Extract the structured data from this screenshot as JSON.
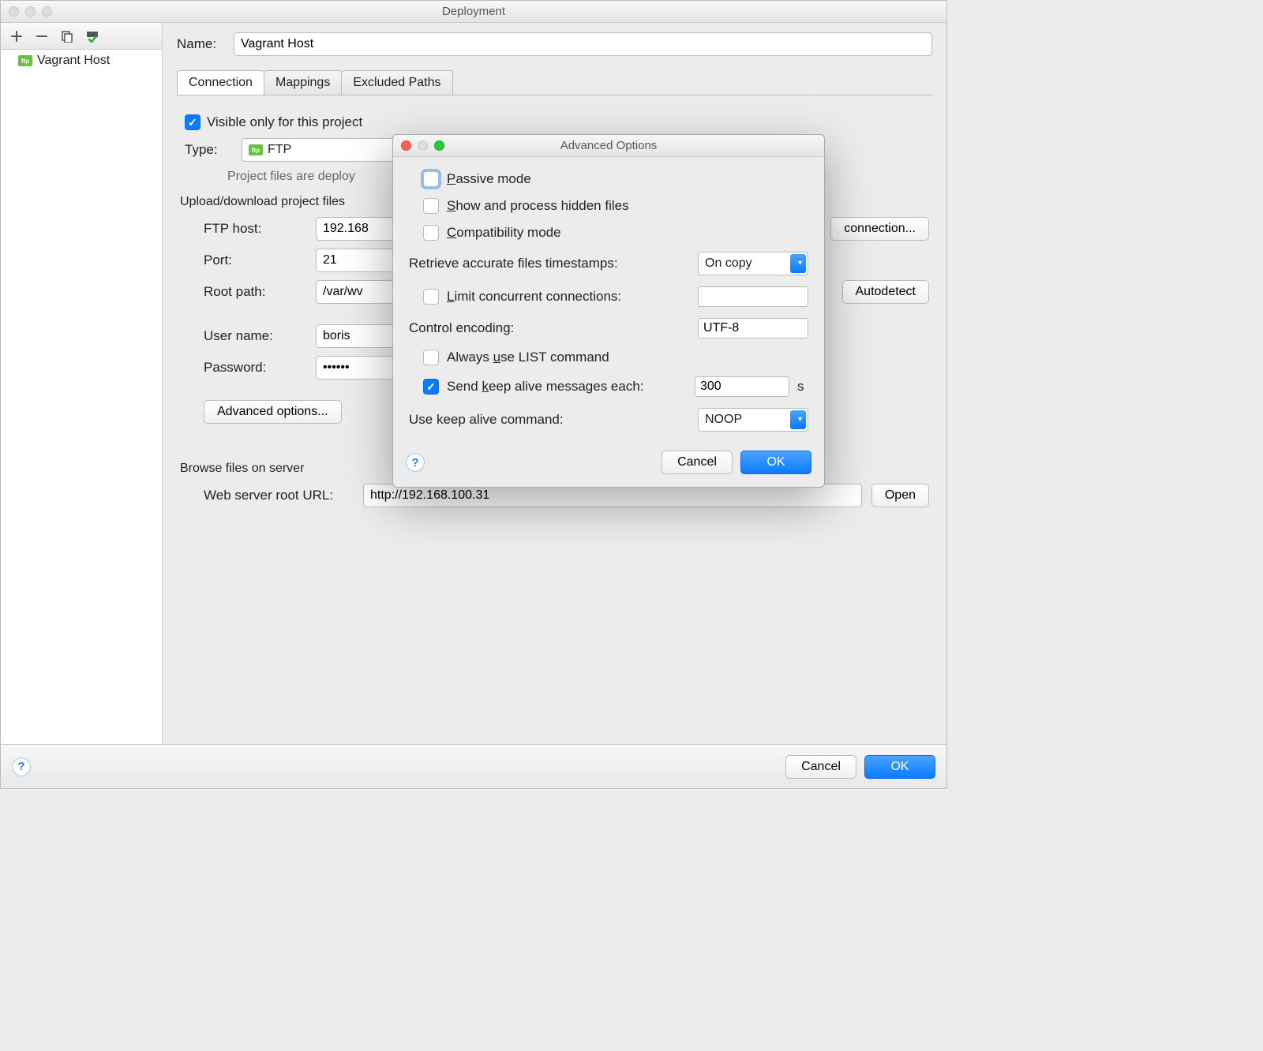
{
  "window": {
    "title": "Deployment"
  },
  "sidebar": {
    "items": [
      {
        "label": "Vagrant Host"
      }
    ]
  },
  "main": {
    "name_label": "Name:",
    "name_value": "Vagrant Host",
    "tabs": [
      {
        "label": "Connection"
      },
      {
        "label": "Mappings"
      },
      {
        "label": "Excluded Paths"
      }
    ],
    "visible_only": {
      "label": "Visible only for this project",
      "checked": true
    },
    "type_label": "Type:",
    "type_value": "FTP",
    "hint": "Project files are deploy",
    "upload_section": "Upload/download project files",
    "ftp_host_label": "FTP host:",
    "ftp_host_value": "192.168",
    "test_btn": "connection...",
    "port_label": "Port:",
    "port_value": "21",
    "root_label": "Root path:",
    "root_value": "/var/wv",
    "autodetect_btn": "Autodetect",
    "user_label": "User name:",
    "user_value": "boris",
    "pass_label": "Password:",
    "pass_value": "••••••",
    "adv_btn": "Advanced options...",
    "browse_section": "Browse files on server",
    "weburl_label": "Web server root URL:",
    "weburl_value": "http://192.168.100.31",
    "open_btn": "Open"
  },
  "footer": {
    "cancel": "Cancel",
    "ok": "OK"
  },
  "modal": {
    "title": "Advanced Options",
    "passive": {
      "label": "Passive mode",
      "checked": false,
      "focused": true
    },
    "show_hidden": {
      "label": "Show and process hidden files",
      "checked": false
    },
    "compat": {
      "label": "Compatibility mode",
      "checked": false
    },
    "timestamps_label": "Retrieve accurate files timestamps:",
    "timestamps_value": "On copy",
    "limit_conn": {
      "label": "Limit concurrent connections:",
      "checked": false,
      "value": ""
    },
    "encoding_label": "Control encoding:",
    "encoding_value": "UTF-8",
    "use_list": {
      "label": "Always use LIST command",
      "checked": false
    },
    "keepalive": {
      "label": "Send keep alive messages each:",
      "checked": true,
      "value": "300",
      "suffix": "s"
    },
    "keepalive_cmd_label": "Use keep alive command:",
    "keepalive_cmd_value": "NOOP",
    "cancel": "Cancel",
    "ok": "OK"
  }
}
